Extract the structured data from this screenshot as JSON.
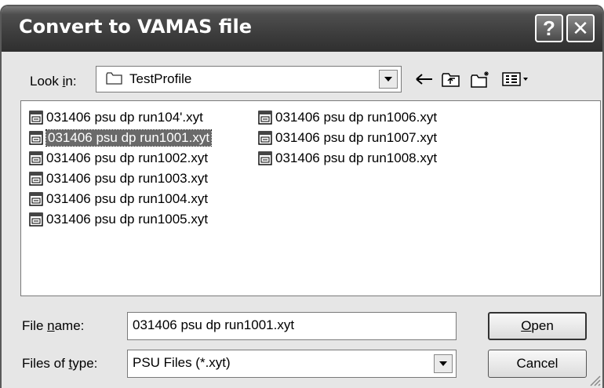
{
  "window": {
    "title": "Convert to VAMAS file",
    "help_glyph": "?",
    "close_glyph": "✕"
  },
  "look_in": {
    "label": "Look in:",
    "value": "TestProfile"
  },
  "files": [
    {
      "name": "031406 psu dp run104'.xyt",
      "selected": false
    },
    {
      "name": "031406 psu dp run1001.xyt",
      "selected": true
    },
    {
      "name": "031406 psu dp run1002.xyt",
      "selected": false
    },
    {
      "name": "031406 psu dp run1003.xyt",
      "selected": false
    },
    {
      "name": "031406 psu dp run1004.xyt",
      "selected": false
    },
    {
      "name": "031406 psu dp run1005.xyt",
      "selected": false
    },
    {
      "name": "031406 psu dp run1006.xyt",
      "selected": false
    },
    {
      "name": "031406 psu dp run1007.xyt",
      "selected": false
    },
    {
      "name": "031406 psu dp run1008.xyt",
      "selected": false
    }
  ],
  "file_name": {
    "label": "File name:",
    "value": "031406 psu dp run1001.xyt"
  },
  "file_type": {
    "label": "Files of type:",
    "value": "PSU Files (*.xyt)"
  },
  "buttons": {
    "open": "Open",
    "cancel": "Cancel"
  },
  "icons": {
    "back": "back-arrow-icon",
    "up": "up-folder-icon",
    "new_folder": "new-folder-icon",
    "view": "view-menu-icon"
  }
}
